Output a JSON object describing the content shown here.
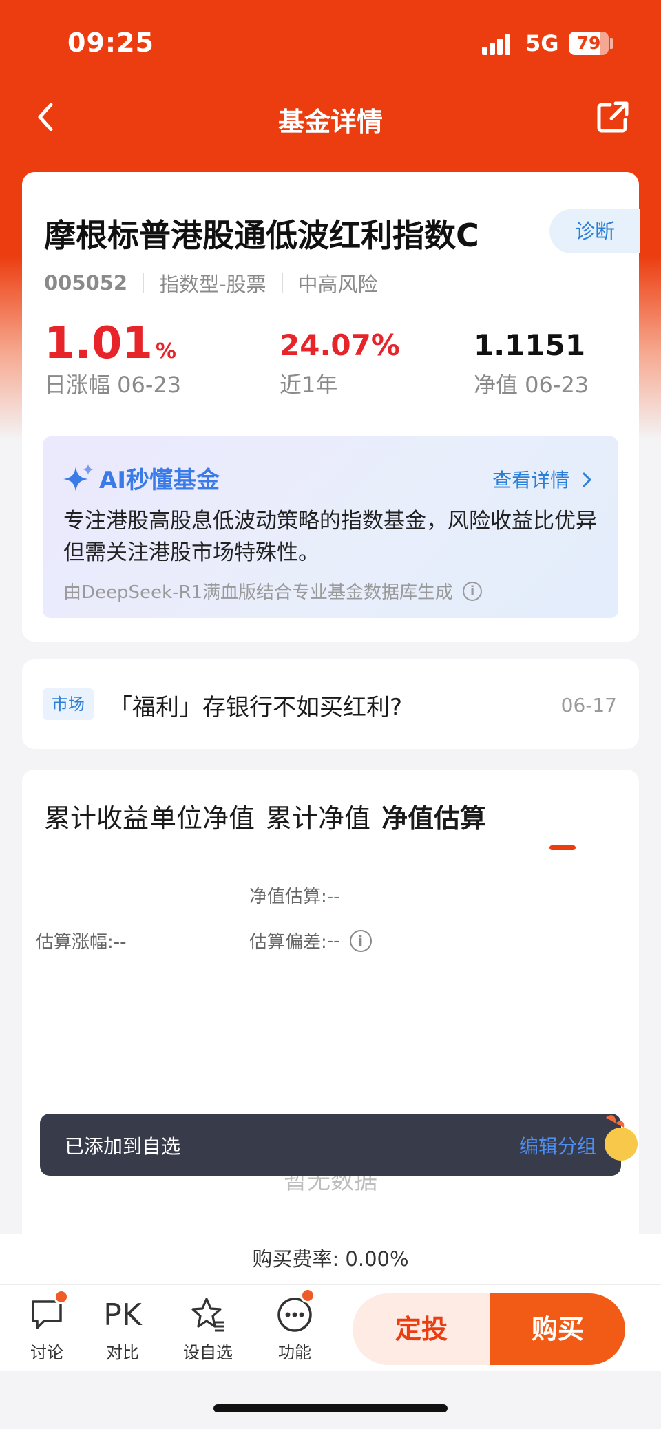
{
  "status_bar": {
    "time": "09:25",
    "network": "5G",
    "battery": "79",
    "battery_level": 0.79
  },
  "nav": {
    "title": "基金详情",
    "back_icon": "chevron-left-icon",
    "share_icon": "share-icon"
  },
  "fund": {
    "name": "摩根标普港股通低波红利指数C",
    "diagnose_label": "诊断",
    "code": "005052",
    "type": "指数型-股票",
    "risk": "中高风险",
    "daily_change_value": "1.01",
    "daily_change_unit": "%",
    "daily_change_label": "日涨幅 06-23",
    "year_return": "24.07%",
    "year_return_label": "近1年",
    "nav_value": "1.1151",
    "nav_label": "净值 06-23"
  },
  "ai": {
    "title": "AI秒懂基金",
    "link": "查看详情",
    "body": "专注港股高股息低波动策略的指数基金，风险收益比优异但需关注港股市场特殊性。",
    "note": "由DeepSeek-R1满血版结合专业基金数据库生成"
  },
  "news": {
    "tag": "市场",
    "text": "「福利」存银行不如买红利?",
    "date": "06-17"
  },
  "chart": {
    "tabs": [
      "累计收益",
      "单位净值",
      "累计净值",
      "净值估算"
    ],
    "active_tab": "净值估算",
    "est_value_label": "净值估算:",
    "est_value": "--",
    "est_change_label": "估算涨幅:",
    "est_change": "--",
    "est_deviation_label": "估算偏差:",
    "est_deviation": "--",
    "empty_text": "暂无数据"
  },
  "toast": {
    "text": "已添加到自选",
    "action": "编辑分组"
  },
  "fee": {
    "text": "购买费率: 0.00%"
  },
  "bottom_bar": {
    "items": [
      {
        "label": "讨论",
        "icon": "chat-icon",
        "badge": true
      },
      {
        "label": "对比",
        "icon": "PK",
        "badge": false
      },
      {
        "label": "设自选",
        "icon": "star-list-icon",
        "badge": false
      },
      {
        "label": "功能",
        "icon": "more-icon",
        "badge": true
      }
    ],
    "sip_label": "定投",
    "buy_label": "购买"
  },
  "colors": {
    "brand": "#ec3d10",
    "up": "#e8242b",
    "link": "#2b7fd8",
    "buy": "#f25b16"
  }
}
